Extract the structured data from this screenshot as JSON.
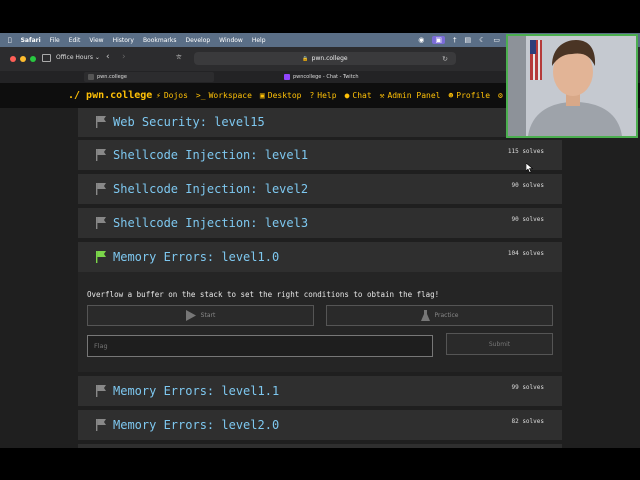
{
  "menubar": {
    "app": "Safari",
    "items": [
      "File",
      "Edit",
      "View",
      "History",
      "Bookmarks",
      "Develop",
      "Window",
      "Help"
    ]
  },
  "browser": {
    "sidebar_group": "Office Hours",
    "address": "pwn.college",
    "tabs": [
      {
        "label": "pwn.college"
      },
      {
        "label": "pwncollege - Chat - Twitch"
      }
    ]
  },
  "site": {
    "brand": "./ pwn.college",
    "nav": [
      {
        "icon": "lightning-icon",
        "label": "Dojos"
      },
      {
        "icon": "terminal-icon",
        "label": "Workspace"
      },
      {
        "icon": "monitor-icon",
        "label": "Desktop"
      },
      {
        "icon": "question-icon",
        "label": "Help"
      },
      {
        "icon": "chat-icon",
        "label": "Chat"
      },
      {
        "icon": "wrench-icon",
        "label": "Admin Panel"
      },
      {
        "icon": "user-icon",
        "label": "Profile"
      }
    ]
  },
  "challenges": [
    {
      "title": "Web Security: level15",
      "solves": ""
    },
    {
      "title": "Shellcode Injection: level1",
      "solves": "115 solves"
    },
    {
      "title": "Shellcode Injection: level2",
      "solves": "90 solves"
    },
    {
      "title": "Shellcode Injection: level3",
      "solves": "90 solves"
    },
    {
      "title": "Memory Errors: level1.0",
      "solves": "104 solves"
    },
    {
      "title": "Memory Errors: level1.1",
      "solves": "99 solves"
    },
    {
      "title": "Memory Errors: level2.0",
      "solves": "82 solves"
    }
  ],
  "expanded": {
    "description": "Overflow a buffer on the stack to set the right conditions to obtain the flag!",
    "start_label": "Start",
    "practice_label": "Practice",
    "flag_placeholder": "Flag",
    "submit_label": "Submit"
  },
  "colors": {
    "accent": "#ffc107",
    "title_blue": "#7ec8f0",
    "solved_flag": "#7bd64a",
    "webcam_border": "#4caf50"
  }
}
